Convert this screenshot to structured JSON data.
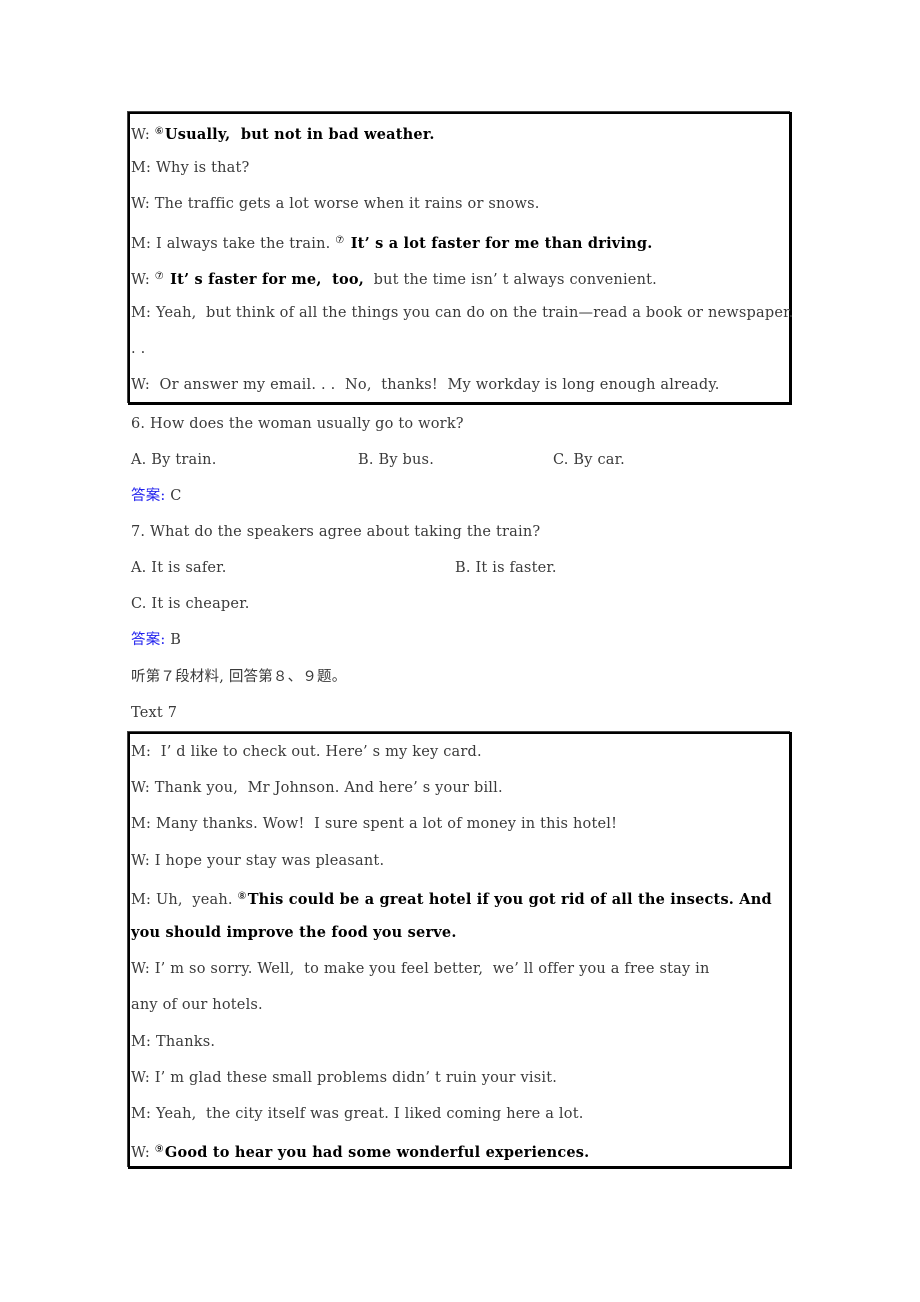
{
  "text6_dialogue": [
    {
      "speaker": "W: ",
      "marker": "⑥",
      "normal_before": "",
      "bold": "Usually,  but not in bad weather.",
      "normal_after": ""
    },
    {
      "speaker": "M: ",
      "marker": "",
      "normal_before": "Why is that?",
      "bold": "",
      "normal_after": ""
    },
    {
      "speaker": "W: ",
      "marker": "",
      "normal_before": "The traffic gets a lot worse when it rains or snows.",
      "bold": "",
      "normal_after": ""
    },
    {
      "speaker": "M: ",
      "marker": "⑦",
      "normal_before": "I always take the train. ",
      "bold": " It’ s a lot faster for me than driving.",
      "normal_after": ""
    },
    {
      "speaker": "W: ",
      "marker": "⑦",
      "normal_before": "",
      "bold": " It’ s faster for me,  too,",
      "normal_after": "  but the time isn’ t always convenient."
    },
    {
      "speaker": "M: ",
      "marker": "",
      "normal_before": "Yeah,  but think of all the things you can do on the train—read a book or newspaper.",
      "bold": "",
      "normal_after": ""
    },
    {
      "speaker": "",
      "marker": "",
      "normal_before": ". .",
      "bold": "",
      "normal_after": ""
    },
    {
      "speaker": "W: ",
      "marker": "",
      "normal_before": " Or answer my email. . .  No,  thanks!  My workday is long enough already.",
      "bold": "",
      "normal_after": ""
    }
  ],
  "questions": [
    {
      "stem": "6. How does the woman usually go to work?",
      "options": [
        "A. By train.",
        "B. By bus.",
        "C. By car."
      ],
      "answer_label": "答案:",
      "answer_value": " C"
    },
    {
      "stem": "7. What do the speakers agree about taking the train?",
      "options": [
        "A. It is safer.",
        "B. It is faster.",
        "C. It is cheaper."
      ],
      "answer_label": "答案:",
      "answer_value": " B"
    }
  ],
  "instruction": "听第７段材料, 回答第８、９题。",
  "text7_title": "Text 7",
  "text7_dialogue": [
    {
      "speaker": "M: ",
      "marker": "",
      "normal_before": " I’ d like to check out. Here’ s my key card.",
      "bold": "",
      "normal_after": ""
    },
    {
      "speaker": "W: ",
      "marker": "",
      "normal_before": "Thank you,  Mr Johnson. And here’ s your bill.",
      "bold": "",
      "normal_after": ""
    },
    {
      "speaker": "M: ",
      "marker": "",
      "normal_before": "Many thanks. Wow!  I sure spent a lot of money in this hotel!",
      "bold": "",
      "normal_after": ""
    },
    {
      "speaker": "W: ",
      "marker": "",
      "normal_before": "I hope your stay was pleasant.",
      "bold": "",
      "normal_after": ""
    },
    {
      "speaker": "M: ",
      "marker": "⑧",
      "normal_before": "Uh,  yeah. ",
      "bold": "This could be a great hotel if you got rid of all the insects. And",
      "normal_after": ""
    },
    {
      "speaker": "",
      "marker": "",
      "normal_before": "",
      "bold": "you should improve the food you serve.",
      "normal_after": ""
    },
    {
      "speaker": "W: ",
      "marker": "",
      "normal_before": "I’ m so sorry. Well,  to make you feel better,  we’ ll offer you a free stay in",
      "bold": "",
      "normal_after": ""
    },
    {
      "speaker": "",
      "marker": "",
      "normal_before": "any of our hotels.",
      "bold": "",
      "normal_after": ""
    },
    {
      "speaker": "M: ",
      "marker": "",
      "normal_before": "Thanks.",
      "bold": "",
      "normal_after": ""
    },
    {
      "speaker": "W: ",
      "marker": "",
      "normal_before": "I’ m glad these small problems didn’ t ruin your visit.",
      "bold": "",
      "normal_after": ""
    },
    {
      "speaker": "M: ",
      "marker": "",
      "normal_before": "Yeah,  the city itself was great. I liked coming here a lot.",
      "bold": "",
      "normal_after": ""
    },
    {
      "speaker": "W: ",
      "marker": "⑨",
      "normal_before": "",
      "bold": "Good to hear you had some wonderful experiences.",
      "normal_after": ""
    }
  ],
  "colors": {
    "answer_label": "#2222ee",
    "body_text": "#3a3a3a",
    "bold_text": "#000000",
    "box_border": "#000000"
  }
}
